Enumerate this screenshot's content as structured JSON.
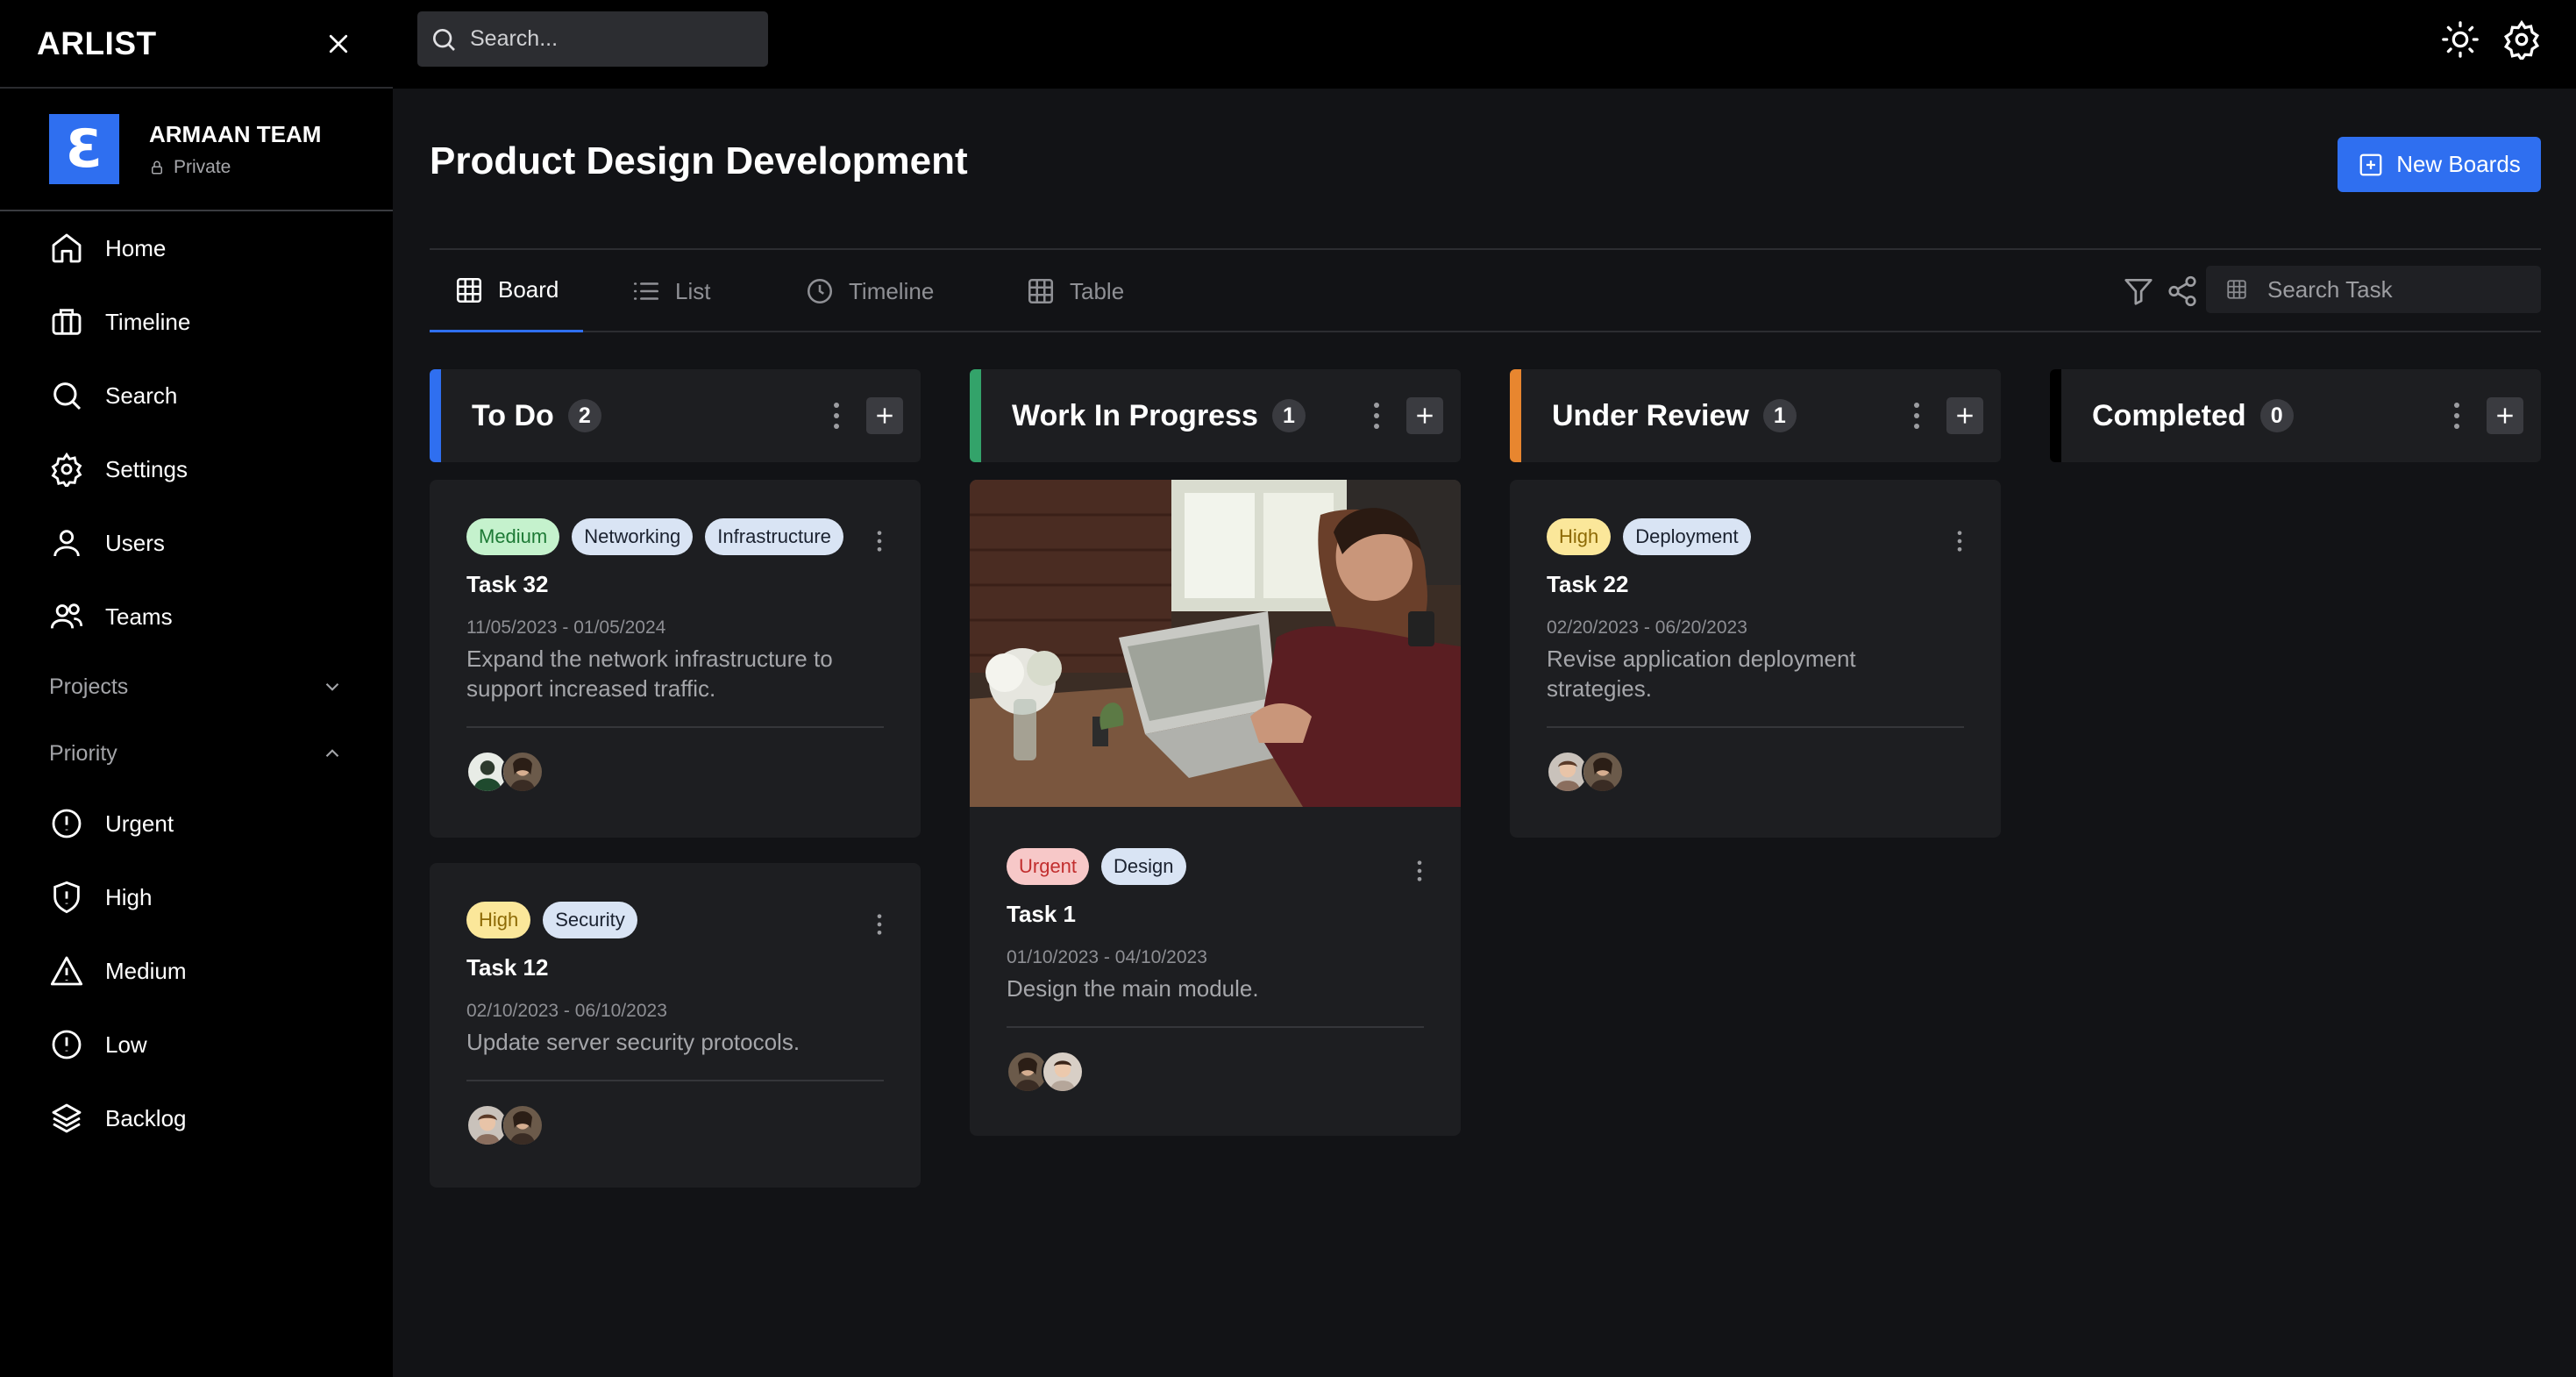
{
  "app": {
    "brand": "ARLIST"
  },
  "team": {
    "name": "ARMAAN TEAM",
    "logo_letter": "Ɛ",
    "visibility": "Private"
  },
  "sidebar": {
    "nav": [
      {
        "label": "Home",
        "icon": "home-icon"
      },
      {
        "label": "Timeline",
        "icon": "timeline-icon"
      },
      {
        "label": "Search",
        "icon": "search-icon"
      },
      {
        "label": "Settings",
        "icon": "gear-icon"
      },
      {
        "label": "Users",
        "icon": "user-icon"
      },
      {
        "label": "Teams",
        "icon": "team-icon"
      }
    ],
    "projects_label": "Projects",
    "priority_label": "Priority",
    "priority": [
      {
        "label": "Urgent",
        "icon": "alert-circle-icon"
      },
      {
        "label": "High",
        "icon": "shield-alert-icon"
      },
      {
        "label": "Medium",
        "icon": "triangle-alert-icon"
      },
      {
        "label": "Low",
        "icon": "alert-octagon-icon"
      },
      {
        "label": "Backlog",
        "icon": "layers-icon"
      }
    ]
  },
  "topbar": {
    "search_placeholder": "Search..."
  },
  "page": {
    "title": "Product Design Development",
    "new_button": "New Boards"
  },
  "tabs": [
    {
      "label": "Board",
      "icon": "grid-icon",
      "active": true
    },
    {
      "label": "List",
      "icon": "list-icon",
      "active": false
    },
    {
      "label": "Timeline",
      "icon": "clock-icon",
      "active": false
    },
    {
      "label": "Table",
      "icon": "table-icon",
      "active": false
    }
  ],
  "toolbar": {
    "search_task_placeholder": "Search Task"
  },
  "colors": {
    "accent": "#2f6ff0",
    "todo": "#2f6ff0",
    "wip": "#33a36a",
    "review": "#e8862f",
    "completed": "#000000",
    "medium_bg": "#c5f2cd",
    "medium_fg": "#1d7a35",
    "high_bg": "#fbe79a",
    "high_fg": "#8d6a05",
    "urgent_bg": "#f7c8c8",
    "urgent_fg": "#c22e2e",
    "neutral_bg": "#d9e4f4",
    "neutral_fg": "#1b2230"
  },
  "columns": [
    {
      "title": "To Do",
      "count": "2"
    },
    {
      "title": "Work In Progress",
      "count": "1"
    },
    {
      "title": "Under Review",
      "count": "1"
    },
    {
      "title": "Completed",
      "count": "0"
    }
  ],
  "cards": {
    "task32": {
      "tags": [
        "Medium",
        "Networking",
        "Infrastructure"
      ],
      "title": "Task 32",
      "dates": "11/05/2023 - 01/05/2024",
      "desc": "Expand the network infrastructure to support increased traffic."
    },
    "task12": {
      "tags": [
        "High",
        "Security"
      ],
      "title": "Task 12",
      "dates": "02/10/2023 - 06/10/2023",
      "desc": "Update server security protocols."
    },
    "task1": {
      "tags": [
        "Urgent",
        "Design"
      ],
      "title": "Task 1",
      "dates": "01/10/2023 - 04/10/2023",
      "desc": "Design the main module."
    },
    "task22": {
      "tags": [
        "High",
        "Deployment"
      ],
      "title": "Task 22",
      "dates": "02/20/2023 - 06/20/2023",
      "desc": "Revise application deployment strategies."
    }
  }
}
